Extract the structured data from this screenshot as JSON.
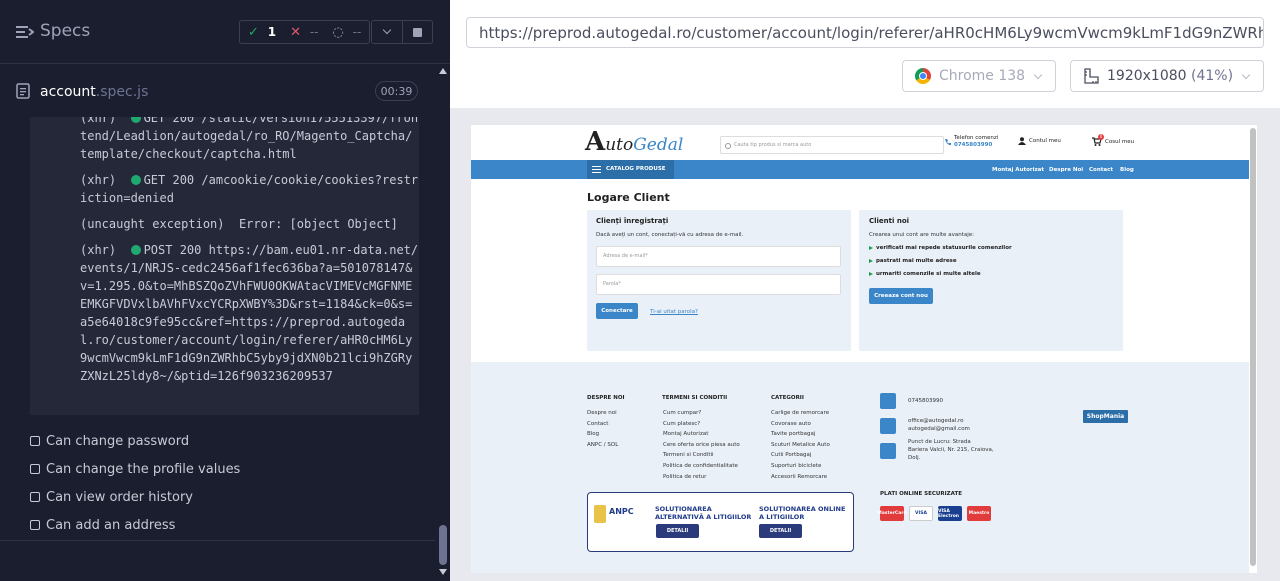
{
  "reporter": {
    "title": "Specs",
    "stats": {
      "passed": "1",
      "failed": "--",
      "pending": "--"
    },
    "file": {
      "name": "account",
      "ext": ".spec.js",
      "duration": "00:39"
    },
    "log": [
      {
        "prefix": "(xhr)",
        "status": "GET 200",
        "text": "/static/version1755513397/frontend/Leadlion/autogedal/ro_RO/Magento_Captcha/template/checkout/captcha.html",
        "dot": true
      },
      {
        "prefix": "(xhr)",
        "status": "GET 200",
        "text": "/amcookie/cookie/cookies?restriction=denied",
        "dot": true
      },
      {
        "prefix": "(uncaught exception)",
        "status": "",
        "text": "Error: [object Object]",
        "dot": false
      },
      {
        "prefix": "(xhr)",
        "status": "POST 200",
        "text": "https://bam.eu01.nr-data.net/events/1/NRJS-cedc2456af1fec636ba?a=501078147&v=1.295.0&to=MhBSZQoZVhFWU0OKWAtacVIMEVcMGFNMEEMKGFVDVxlbAVhFVxcYCRpXWBY%3D&rst=1184&ck=0&s=a5e64018c9fe95cc&ref=https://preprod.autogedal.ro/customer/account/login/referer/aHR0cHM6Ly9wcmVwcm9kLmF1dG9nZWRhbC5yby9jdXN0b21lci9hZGRyZXNzL25ldy8~/&ptid=126f903236209537",
        "dot": true
      }
    ],
    "tests": [
      "Can change password",
      "Can change the profile values",
      "Can view order history",
      "Can add an address"
    ]
  },
  "aut": {
    "url": "https://preprod.autogedal.ro/customer/account/login/referer/aHR0cHM6Ly9wcmVwcm9kLmF1dG9nZWRhbC5yby9jdXN0b21lci9hZGRyZXNzL25ldy8~/",
    "browser": "Chrome 138",
    "viewport": "1920x1080",
    "zoom": "(41%)"
  },
  "site": {
    "logo": {
      "a": "A",
      "uto": "uto",
      "gedal": "Gedal"
    },
    "search_placeholder": "Cauta tip produs si marca auto",
    "phone_label": "Telefon comenzi",
    "phone": "0745803990",
    "account": "Contul meu",
    "cart": "Cosul meu",
    "cart_count": "0",
    "catalog": "CATALOG PRODUSE",
    "nav": [
      "Montaj Autorizat",
      "Despre Noi",
      "Contact",
      "Blog"
    ],
    "page_title": "Logare Client",
    "registered": {
      "title": "Clienți înregistrați",
      "desc": "Dacă aveți un cont, conectați-vă cu adresa de e-mail.",
      "email_ph": "Adresa de e-mail*",
      "pass_ph": "Parola*",
      "login_btn": "Conectare",
      "forgot": "Ti-ai uitat parola?"
    },
    "new": {
      "title": "Clienti noi",
      "desc": "Crearea unui cont are multe avantaje:",
      "bullets": [
        "verificati mai repede statusurile comenzilor",
        "pastrati mai multe adrese",
        "urmariti comenzile si multe altele"
      ],
      "btn": "Creeaza cont nou"
    },
    "footer": {
      "col1": {
        "title": "DESPRE NOI",
        "links": [
          "Despre noi",
          "Contact",
          "Blog",
          "ANPC / SOL"
        ]
      },
      "col2": {
        "title": "TERMENI SI CONDITII",
        "links": [
          "Cum cumpar?",
          "Cum platesc?",
          "Montaj Autorizat",
          "Cere oferta orice piesa auto",
          "Termeni si Conditii",
          "Politica de confidentialitate",
          "Politica de retur"
        ]
      },
      "col3": {
        "title": "CATEGORII",
        "links": [
          "Carlige de remorcare",
          "Covorase auto",
          "Tavite portbagaj",
          "Scuturi Metalice Auto",
          "Cutii Portbagaj",
          "Suporturi biciclete",
          "Accesorii Remorcare"
        ]
      },
      "phone": "0745803990",
      "email1": "office@autogedal.ro",
      "email2": "autogedal@gmail.com",
      "address": [
        "Punct de Lucru: Strada",
        "Bariera Valcii, Nr. 215, Craiova,",
        "Dolj."
      ],
      "badge": "ShopMania",
      "secure": "PLATI ONLINE SECURIZATE",
      "anpc": "ANPC",
      "anpc_left": [
        "SOLUȚIONAREA",
        "ALTERNATIVĂ A LITIGIILOR"
      ],
      "anpc_right": [
        "SOLUȚIONAREA ONLINE",
        "A LITIGIILOR"
      ],
      "details": "DETALII",
      "cards": [
        "MasterCard",
        "VISA",
        "VISA Electron",
        "Maestro"
      ]
    }
  }
}
